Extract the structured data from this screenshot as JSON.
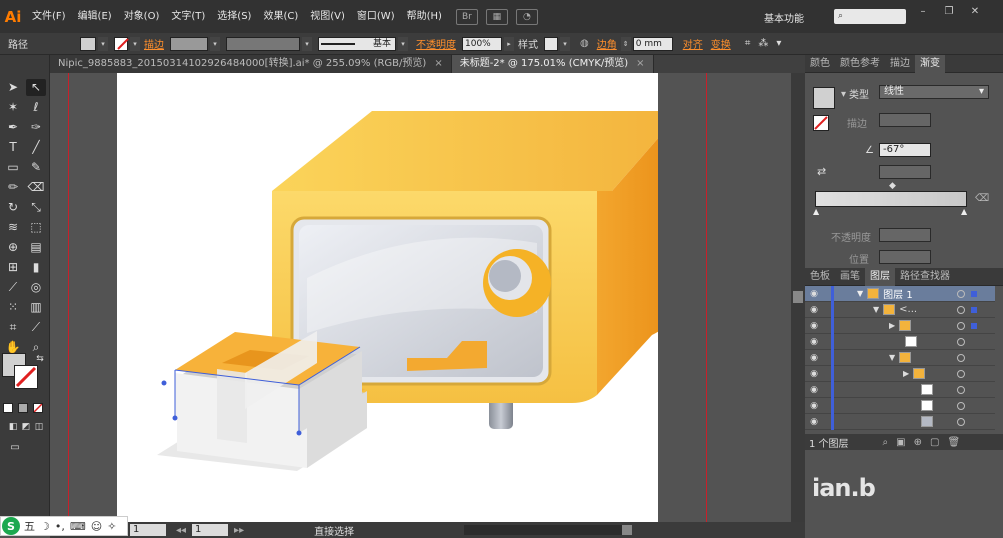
{
  "menubar": {
    "logo": "Ai",
    "items": [
      "文件(F)",
      "编辑(E)",
      "对象(O)",
      "文字(T)",
      "选择(S)",
      "效果(C)",
      "视图(V)",
      "窗口(W)",
      "帮助(H)"
    ],
    "workspace": "基本功能",
    "search_placeholder": ""
  },
  "control_bar": {
    "path_label": "路径",
    "stroke_label": "描边",
    "stroke_style": "基本",
    "opacity_label": "不透明度",
    "opacity_value": "100%",
    "style_label": "样式",
    "corner_label": "边角",
    "corner_value": "0 mm",
    "align_label": "对齐",
    "transform_label": "变换"
  },
  "doc_tabs": [
    {
      "label": "Nipic_9885883_20150314102926484000[转换].ai* @ 255.09% (RGB/预览)",
      "close": "×"
    },
    {
      "label": "未标题-2* @ 175.01% (CMYK/预览)",
      "close": "×"
    }
  ],
  "status_bar": {
    "zoom": "1",
    "page": "1",
    "tool": "直接选择"
  },
  "gradient_panel": {
    "tabs": [
      "颜色",
      "颜色参考",
      "描边",
      "渐变"
    ],
    "type_label": "类型",
    "type_value": "线性",
    "stroke_label": "描边",
    "angle_value": "-67°",
    "opacity_label": "不透明度",
    "position_label": "位置"
  },
  "layers_panel": {
    "tabs": [
      "色板",
      "画笔",
      "图层",
      "路径查找器"
    ],
    "layer_name": "图层 1",
    "group_name": "<...",
    "footer": "1 个图层"
  },
  "colors": {
    "accent": "#ff7c00",
    "selection": "#3f5fd9",
    "guide": "#c8202a",
    "safe_light": "#f7c94f",
    "safe_dark": "#ee9a1b"
  },
  "ime": {
    "label": "五"
  },
  "watermark": {
    "text": "ian.b"
  }
}
